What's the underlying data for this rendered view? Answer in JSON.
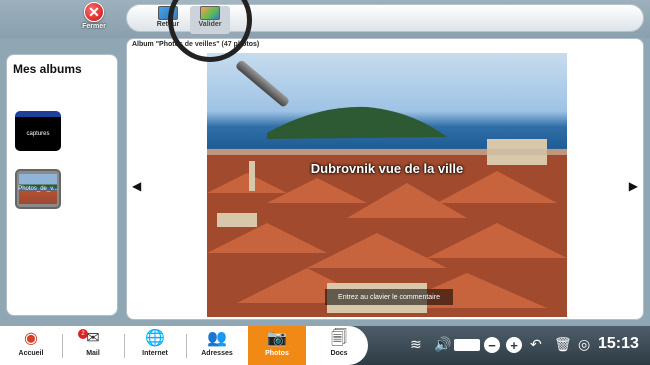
{
  "toolbar": {
    "close_label": "Fermer",
    "buttons": [
      {
        "label": "Retour"
      },
      {
        "label": "Valider"
      }
    ]
  },
  "albums": {
    "title": "Mes albums",
    "items": [
      {
        "label": "captures"
      },
      {
        "label": "Photos_de_v..."
      }
    ]
  },
  "viewer": {
    "album_caption": "Album \"Photos de veilles\" (47 photos)",
    "photo_title": "Dubrovnik vue de la ville",
    "comment_placeholder": "Entrez au clavier le commentaire",
    "prev_arrow": "◀",
    "next_arrow": "▶"
  },
  "taskbar": {
    "items": [
      {
        "label": "Accueil",
        "icon": "home-icon"
      },
      {
        "label": "Mail",
        "icon": "mail-icon",
        "badge": "2"
      },
      {
        "label": "Internet",
        "icon": "globe-icon"
      },
      {
        "label": "Adresses",
        "icon": "contacts-icon"
      },
      {
        "label": "Photos",
        "icon": "camera-icon"
      },
      {
        "label": "Docs",
        "icon": "documents-icon"
      }
    ],
    "clock": "15:13"
  },
  "colors": {
    "accent": "#f08a14",
    "taskbar": "#2e3b44"
  }
}
